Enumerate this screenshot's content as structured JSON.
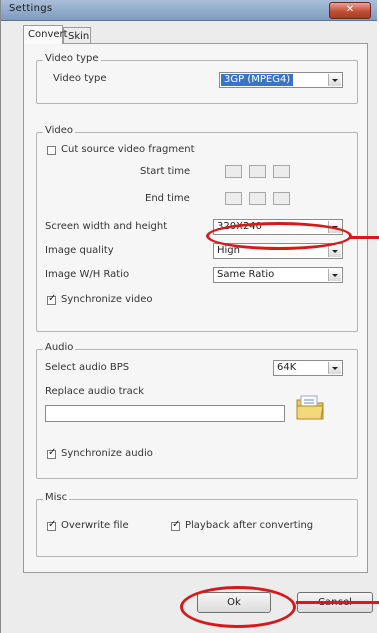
{
  "window": {
    "title": "Settings",
    "close_label": "✕"
  },
  "tabs": [
    {
      "label": "Convert"
    },
    {
      "label": "Skin"
    }
  ],
  "video_type_group": {
    "title": "Video type",
    "label": "Video type",
    "value": "3GP (MPEG4)"
  },
  "video_group": {
    "title": "Video",
    "cut_fragment_label": "Cut source video fragment",
    "cut_fragment_checked": false,
    "start_time_label": "Start time",
    "end_time_label": "End time",
    "screen_size_label": "Screen width and height",
    "screen_size_value": "320X240",
    "image_quality_label": "Image quality",
    "image_quality_value": "High",
    "image_ratio_label": "Image W/H Ratio",
    "image_ratio_value": "Same Ratio",
    "sync_video_label": "Synchronize video",
    "sync_video_checked": true
  },
  "audio_group": {
    "title": "Audio",
    "bps_label": "Select audio BPS",
    "bps_value": "64K",
    "replace_label": "Replace audio track",
    "replace_value": "",
    "sync_audio_label": "Synchronize audio",
    "sync_audio_checked": true
  },
  "misc_group": {
    "title": "Misc",
    "overwrite_label": "Overwrite file",
    "overwrite_checked": true,
    "playback_label": "Playback after converting",
    "playback_checked": true
  },
  "buttons": {
    "ok_label": "Ok",
    "cancel_label": "Cancel"
  },
  "colors": {
    "annotation": "#d61a1a",
    "selection": "#3d73c6"
  }
}
